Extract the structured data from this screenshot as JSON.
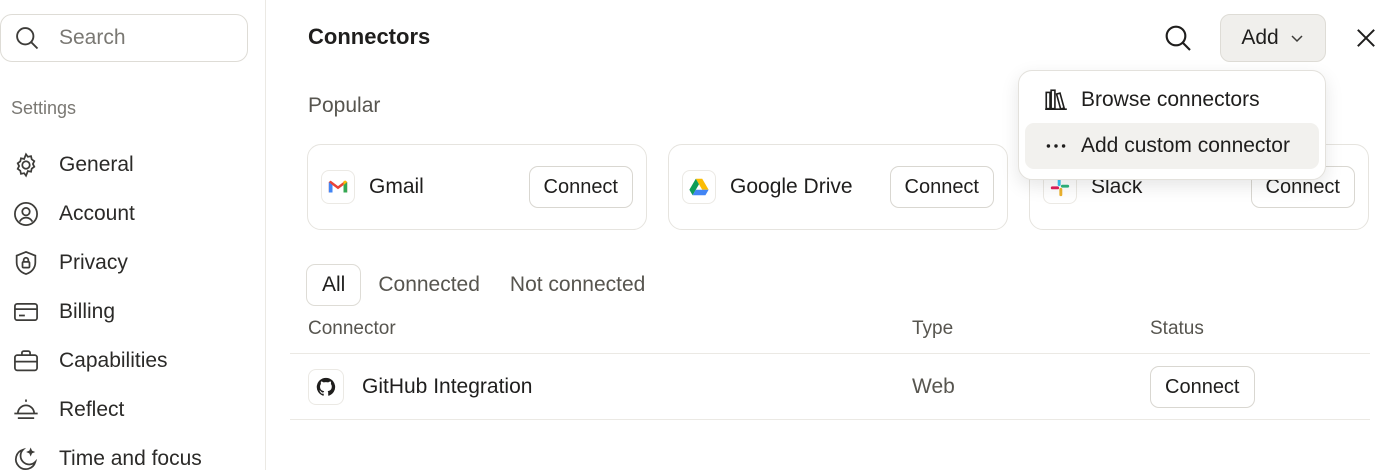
{
  "sidebar": {
    "search_placeholder": "Search",
    "heading": "Settings",
    "items": [
      {
        "label": "General",
        "icon": "gear-icon"
      },
      {
        "label": "Account",
        "icon": "user-circle-icon"
      },
      {
        "label": "Privacy",
        "icon": "shield-lock-icon"
      },
      {
        "label": "Billing",
        "icon": "credit-card-icon"
      },
      {
        "label": "Capabilities",
        "icon": "briefcase-icon"
      },
      {
        "label": "Reflect",
        "icon": "sunrise-icon"
      },
      {
        "label": "Time and focus",
        "icon": "moon-icon"
      }
    ]
  },
  "header": {
    "title": "Connectors",
    "add_label": "Add"
  },
  "popular": {
    "label": "Popular",
    "cards": [
      {
        "name": "Gmail",
        "button": "Connect",
        "icon": "gmail-icon"
      },
      {
        "name": "Google Drive",
        "button": "Connect",
        "icon": "google-drive-icon"
      },
      {
        "name": "Slack",
        "button": "Connect",
        "icon": "slack-icon"
      }
    ]
  },
  "tabs": [
    "All",
    "Connected",
    "Not connected"
  ],
  "table": {
    "columns": [
      "Connector",
      "Type",
      "Status"
    ],
    "rows": [
      {
        "name": "GitHub Integration",
        "type": "Web",
        "status": "Connect",
        "icon": "github-icon"
      }
    ]
  },
  "menu": {
    "items": [
      {
        "label": "Browse connectors",
        "icon": "books-icon"
      },
      {
        "label": "Add custom connector",
        "icon": "ellipsis-icon"
      }
    ]
  },
  "colors": {
    "accent_bg": "#f0efec",
    "border": "#e6e4df",
    "text": "#1f1e1d",
    "muted": "#57554f"
  }
}
